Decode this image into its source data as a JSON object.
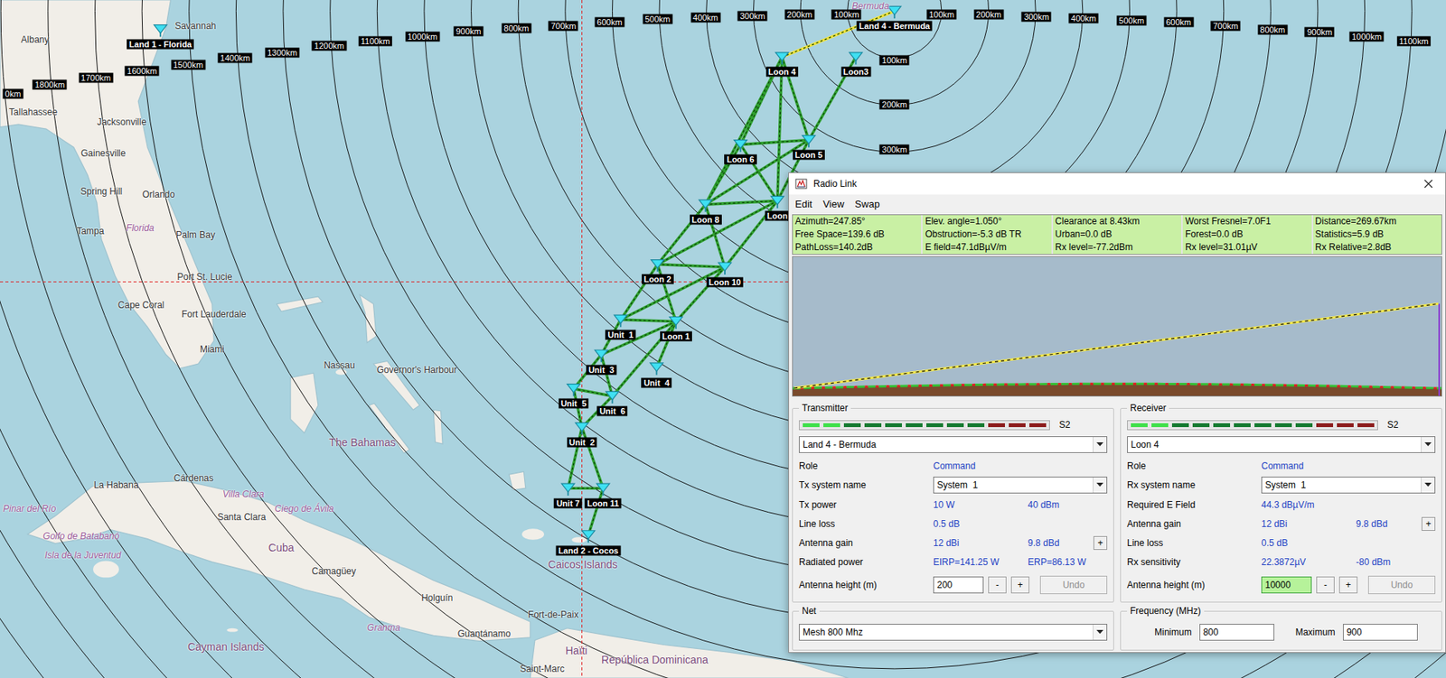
{
  "map": {
    "range_labels": [
      "0km",
      "1800km",
      "1700km",
      "1600km",
      "1500km",
      "1400km",
      "1300km",
      "1200km",
      "1100km",
      "1000km",
      "900km",
      "800km",
      "700km",
      "600km",
      "500km",
      "400km",
      "300km",
      "200km",
      "100km",
      "100km",
      "200km",
      "300km",
      "400km",
      "500km",
      "600km",
      "700km",
      "800km",
      "900km",
      "1000km",
      "1100km",
      "100km",
      "200km",
      "300km"
    ],
    "places": [
      {
        "name": "Albany",
        "kind": "city"
      },
      {
        "name": "Savannah",
        "kind": "city"
      },
      {
        "name": "Tallahassee",
        "kind": "city"
      },
      {
        "name": "Jacksonville",
        "kind": "city"
      },
      {
        "name": "Gainesville",
        "kind": "city"
      },
      {
        "name": "Spring Hill",
        "kind": "city"
      },
      {
        "name": "Orlando",
        "kind": "city"
      },
      {
        "name": "Florida",
        "kind": "region"
      },
      {
        "name": "Tampa",
        "kind": "city"
      },
      {
        "name": "Palm Bay",
        "kind": "city"
      },
      {
        "name": "Port St. Lucie",
        "kind": "city"
      },
      {
        "name": "Cape Coral",
        "kind": "city"
      },
      {
        "name": "Fort Lauderdale",
        "kind": "city"
      },
      {
        "name": "Miami",
        "kind": "city"
      },
      {
        "name": "Nassau",
        "kind": "city"
      },
      {
        "name": "Governor's Harbour",
        "kind": "city"
      },
      {
        "name": "The Bahamas",
        "kind": "country"
      },
      {
        "name": "La Habana",
        "kind": "city"
      },
      {
        "name": "Cárdenas",
        "kind": "city"
      },
      {
        "name": "Villa Clara",
        "kind": "region"
      },
      {
        "name": "Pinar del Río",
        "kind": "region"
      },
      {
        "name": "Santa Clara",
        "kind": "city"
      },
      {
        "name": "Ciego de Ávila",
        "kind": "region"
      },
      {
        "name": "Golfo de Batabanó",
        "kind": "region"
      },
      {
        "name": "Isla de la Juventud",
        "kind": "region"
      },
      {
        "name": "Cuba",
        "kind": "country"
      },
      {
        "name": "Camagüey",
        "kind": "city"
      },
      {
        "name": "Holguín",
        "kind": "city"
      },
      {
        "name": "Granma",
        "kind": "region"
      },
      {
        "name": "Guantánamo",
        "kind": "city"
      },
      {
        "name": "Cayman Islands",
        "kind": "country"
      },
      {
        "name": "Fort-de-Paix",
        "kind": "city"
      },
      {
        "name": "Haïti",
        "kind": "country"
      },
      {
        "name": "Saint-Marc",
        "kind": "city"
      },
      {
        "name": "República Dominicana",
        "kind": "country"
      },
      {
        "name": "Caicos Islands",
        "kind": "country"
      },
      {
        "name": "Bermuda",
        "kind": "region"
      }
    ],
    "nodes": [
      {
        "label": "Land 1 - Florida"
      },
      {
        "label": "Land 4 - Bermuda"
      },
      {
        "label": "Loon 4"
      },
      {
        "label": "Loon3"
      },
      {
        "label": "Loon 6"
      },
      {
        "label": "Loon 5"
      },
      {
        "label": "Loon 8"
      },
      {
        "label": "Loon"
      },
      {
        "label": "Loon 2"
      },
      {
        "label": "Loon 10"
      },
      {
        "label": "Unit  1"
      },
      {
        "label": "Loon 1"
      },
      {
        "label": "Unit  3"
      },
      {
        "label": "Unit  4"
      },
      {
        "label": "Unit  5"
      },
      {
        "label": "Unit  6"
      },
      {
        "label": "Unit  2"
      },
      {
        "label": "Unit 7"
      },
      {
        "label": "Loon 11"
      },
      {
        "label": "Land 2 - Cocos"
      }
    ],
    "links": [
      {
        "from": "Land 4 - Bermuda",
        "to": "Loon 4",
        "color": "#f2e43a"
      },
      {
        "from": "Loon 4",
        "to": "Loon 6",
        "color": "#2fa12f"
      },
      {
        "from": "Loon 4",
        "to": "Loon 5",
        "color": "#2fa12f"
      },
      {
        "from": "Loon 4",
        "to": "Loon 8",
        "color": "#2fa12f"
      },
      {
        "from": "Loon 4",
        "to": "Loon",
        "color": "#2fa12f"
      },
      {
        "from": "Loon3",
        "to": "Loon 5",
        "color": "#2fa12f"
      },
      {
        "from": "Loon 6",
        "to": "Loon 5",
        "color": "#2fa12f"
      },
      {
        "from": "Loon 6",
        "to": "Loon 8",
        "color": "#2fa12f"
      },
      {
        "from": "Loon 6",
        "to": "Loon",
        "color": "#2fa12f"
      },
      {
        "from": "Loon 5",
        "to": "Loon 8",
        "color": "#2fa12f"
      },
      {
        "from": "Loon 5",
        "to": "Loon",
        "color": "#2fa12f"
      },
      {
        "from": "Loon 8",
        "to": "Loon 2",
        "color": "#2fa12f"
      },
      {
        "from": "Loon 8",
        "to": "Loon",
        "color": "#2fa12f"
      },
      {
        "from": "Loon 8",
        "to": "Loon 10",
        "color": "#2fa12f"
      },
      {
        "from": "Loon",
        "to": "Loon 2",
        "color": "#2fa12f"
      },
      {
        "from": "Loon",
        "to": "Loon 10",
        "color": "#2fa12f"
      },
      {
        "from": "Loon 2",
        "to": "Loon 10",
        "color": "#2fa12f"
      },
      {
        "from": "Loon 2",
        "to": "Unit  1",
        "color": "#2fa12f"
      },
      {
        "from": "Loon 2",
        "to": "Loon 1",
        "color": "#2fa12f"
      },
      {
        "from": "Loon 10",
        "to": "Loon 1",
        "color": "#2fa12f"
      },
      {
        "from": "Loon 10",
        "to": "Unit  1",
        "color": "#2fa12f"
      },
      {
        "from": "Unit  1",
        "to": "Loon 1",
        "color": "#2fa12f"
      },
      {
        "from": "Unit  1",
        "to": "Unit  3",
        "color": "#2fa12f"
      },
      {
        "from": "Loon 1",
        "to": "Unit  3",
        "color": "#2fa12f"
      },
      {
        "from": "Loon 1",
        "to": "Unit  4",
        "color": "#2fa12f"
      },
      {
        "from": "Loon 1",
        "to": "Unit  6",
        "color": "#2fa12f"
      },
      {
        "from": "Unit  3",
        "to": "Unit  5",
        "color": "#2fa12f"
      },
      {
        "from": "Unit  3",
        "to": "Unit  6",
        "color": "#2fa12f"
      },
      {
        "from": "Unit  5",
        "to": "Unit  6",
        "color": "#2fa12f"
      },
      {
        "from": "Unit  5",
        "to": "Unit  2",
        "color": "#2fa12f"
      },
      {
        "from": "Unit  6",
        "to": "Unit  2",
        "color": "#2fa12f"
      },
      {
        "from": "Unit  2",
        "to": "Unit 7",
        "color": "#2fa12f"
      },
      {
        "from": "Unit  2",
        "to": "Loon 11",
        "color": "#2fa12f"
      },
      {
        "from": "Unit 7",
        "to": "Loon 11",
        "color": "#2fa12f"
      },
      {
        "from": "Loon 11",
        "to": "Land 2 - Cocos",
        "color": "#2fa12f"
      }
    ]
  },
  "dialog": {
    "title": "Radio Link",
    "menu": [
      "Edit",
      "View",
      "Swap"
    ],
    "metrics": [
      [
        "Azimuth=247.85°",
        "Elev. angle=1.050°",
        "Clearance at 8.43km",
        "Worst Fresnel=7.0F1",
        "Distance=269.67km"
      ],
      [
        "Free Space=139.6 dB",
        "Obstruction=-5.3 dB TR",
        "Urban=0.0 dB",
        "Forest=0.0 dB",
        "Statistics=5.9 dB"
      ],
      [
        "PathLoss=140.2dB",
        "E field=47.1dBµV/m",
        "Rx level=-77.2dBm",
        "Rx level=31.01µV",
        "Rx Relative=2.8dB"
      ]
    ],
    "profile": {
      "ray": [
        200,
        10000
      ],
      "terrain": [
        0,
        0,
        0,
        0,
        0,
        0,
        0,
        0,
        0,
        0,
        0
      ]
    },
    "stations": [
      {
        "title": "Transmitter",
        "signal": {
          "level": 0.17,
          "label": "S2"
        },
        "unit": "Land 4 - Bermuda",
        "rows": [
          {
            "kind": "value",
            "label": "Role",
            "value": "Command"
          },
          {
            "kind": "select",
            "label": "Tx system name",
            "value": "System  1"
          },
          {
            "kind": "value",
            "label": "Tx power",
            "value": "10 W",
            "value2": "40 dBm"
          },
          {
            "kind": "value",
            "label": "Line loss",
            "value": "0.5 dB"
          },
          {
            "kind": "value",
            "label": "Antenna gain",
            "value": "12 dBi",
            "value2": "9.8 dBd",
            "button": "+"
          },
          {
            "kind": "value",
            "label": "Radiated power",
            "value": "EIRP=141.25 W",
            "value2": "ERP=86.13 W"
          }
        ],
        "height": {
          "label": "Antenna height (m)",
          "value": "200",
          "minus": "-",
          "plus": "+",
          "undo": "Undo",
          "undo_disabled": true,
          "highlighted": false
        }
      },
      {
        "title": "Receiver",
        "signal": {
          "level": 0.17,
          "label": "S2"
        },
        "unit": "Loon 4",
        "rows": [
          {
            "kind": "value",
            "label": "Role",
            "value": "Command"
          },
          {
            "kind": "select",
            "label": "Rx system name",
            "value": "System  1"
          },
          {
            "kind": "value",
            "label": "Required E Field",
            "value": "44.3 dBµV/m"
          },
          {
            "kind": "value",
            "label": "Antenna gain",
            "value": "12 dBi",
            "value2": "9.8 dBd",
            "button": "+"
          },
          {
            "kind": "value",
            "label": "Line loss",
            "value": "0.5 dB"
          },
          {
            "kind": "value",
            "label": "Rx sensitivity",
            "value": "22.3872µV",
            "value2": "-80 dBm"
          }
        ],
        "height": {
          "label": "Antenna height (m)",
          "value": "10000",
          "minus": "-",
          "plus": "+",
          "undo": "Undo",
          "undo_disabled": true,
          "highlighted": true
        }
      }
    ],
    "net": {
      "title": "Net",
      "value": "Mesh 800 Mhz"
    },
    "frequency": {
      "title": "Frequency (MHz)",
      "min_label": "Minimum",
      "min": "800",
      "max_label": "Maximum",
      "max": "900"
    }
  }
}
